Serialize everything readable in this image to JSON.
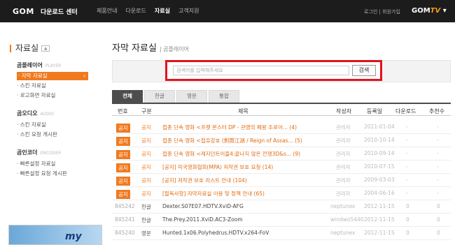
{
  "topbar": {
    "logo": "GOM",
    "logo_sub": "다운로드 센터",
    "nav": [
      {
        "label": "제품안내",
        "active": false
      },
      {
        "label": "다운로드",
        "active": false
      },
      {
        "label": "자료실",
        "active": true
      },
      {
        "label": "고객지원",
        "active": false
      }
    ],
    "login": "로그인",
    "signup": "회원가입",
    "gomtv": "GOM",
    "gomtv_suffix": "TV"
  },
  "sidebar": {
    "title": "자료실",
    "title_button": "▲",
    "sections": [
      {
        "name": "곰플레이어",
        "sub": "PLAYER",
        "items": [
          {
            "label": "· 자막 자료실",
            "active": true
          },
          {
            "label": "· 스킨 자료실",
            "active": false
          },
          {
            "label": "· 로고화면 자료실",
            "active": false
          }
        ]
      },
      {
        "name": "곰오디오",
        "sub": "AUDIO",
        "items": [
          {
            "label": "· 스킨 자료실",
            "active": false
          },
          {
            "label": "· 스킨 요청 게시판",
            "active": false
          }
        ]
      },
      {
        "name": "곰인코더",
        "sub": "ENCODER",
        "items": [
          {
            "label": "· 빠른설정 자료실",
            "active": false
          },
          {
            "label": "· 빠른설정 요청 게시판",
            "active": false
          }
        ]
      }
    ],
    "banner_text": "my"
  },
  "main": {
    "title": "자막 자료실",
    "subtitle": "| 곰플레이어",
    "search": {
      "placeholder": "검색어를 입력해주세요",
      "button": "검색"
    },
    "tabs": [
      {
        "label": "전체",
        "active": true
      },
      {
        "label": "한글",
        "active": false
      },
      {
        "label": "영문",
        "active": false
      },
      {
        "label": "통합",
        "active": false
      }
    ],
    "columns": [
      "번호",
      "구분",
      "제목",
      "작성자",
      "등록일",
      "다운로드",
      "추천수"
    ],
    "rows": [
      {
        "num": "공지",
        "type": "공지",
        "title": "접종 단속 영화 <프렛 몬스터 DP - 관영의 페왕 조로아... (4)",
        "author": "관리자",
        "date": "2011-01-04",
        "downloads": "-",
        "recs": "-",
        "notice": true
      },
      {
        "num": "공지",
        "type": "공지",
        "title": "접종 단속 영화 <접유강호 (剣雨江湖 / Reign of Assas... (5)",
        "author": "관리자",
        "date": "2010-10-14",
        "downloads": "-",
        "recs": "-",
        "notice": true
      },
      {
        "num": "공지",
        "type": "공지",
        "title": "접종 단속 영화 <레지던트이블4:끝나지 않은 전쟁3D&s... (9)",
        "author": "관리자",
        "date": "2010-09-14",
        "downloads": "-",
        "recs": "-",
        "notice": true
      },
      {
        "num": "공지",
        "type": "공지",
        "title": "[공지] 미국영화협회(MPA) 저작권 보호 요청 (14)",
        "author": "관리자",
        "date": "2010-07-15",
        "downloads": "-",
        "recs": "-",
        "notice": true
      },
      {
        "num": "공지",
        "type": "공지",
        "title": "[공지] 저작권 보호 리스트 안내 (104)",
        "author": "관리자",
        "date": "2009-03-03",
        "downloads": "-",
        "recs": "-",
        "notice": true
      },
      {
        "num": "공지",
        "type": "공지",
        "title": "[필독사항] 자막자료실 이용 및 정책 안내 (65)",
        "author": "관리자",
        "date": "2004-06-16",
        "downloads": "-",
        "recs": "-",
        "notice": true
      },
      {
        "num": "845242",
        "type": "한글",
        "title": "Dexter.S07E07.HDTV.XviD-AFG",
        "author": "neptunex",
        "date": "2012-11-15",
        "downloads": "0",
        "recs": "0",
        "notice": false
      },
      {
        "num": "845241",
        "type": "한글",
        "title": "The.Prey.2011.XviD.AC3-Zoom",
        "author": "windwo5440",
        "date": "2012-11-15",
        "downloads": "0",
        "recs": "0",
        "notice": false
      },
      {
        "num": "845240",
        "type": "영문",
        "title": "Hunted.1x06.Polyhedrus.HDTV.x264-FoV",
        "author": "neptunex",
        "date": "2012-11-15",
        "downloads": "0",
        "recs": "0",
        "notice": false
      }
    ]
  }
}
